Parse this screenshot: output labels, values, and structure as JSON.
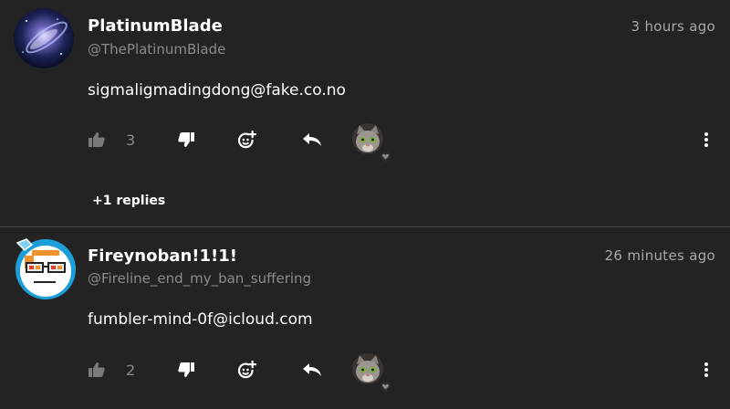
{
  "comments": [
    {
      "author": "PlatinumBlade",
      "handle": "@ThePlatinumBlade",
      "time": "3 hours ago",
      "text": "sigmaligmadingdong@fake.co.no",
      "likes": "3",
      "replies_label": "+1 replies",
      "avatar_icon": "galaxy-avatar",
      "reaction_icon": "cat-reaction-avatar"
    },
    {
      "author": "Fireynoban!1!1!",
      "handle": "@Fireline_end_my_ban_suffering",
      "time": "26 minutes ago",
      "text": "fumbler-mind-0f@icloud.com",
      "likes": "2",
      "avatar_icon": "pixel-face-avatar",
      "reaction_icon": "cat-reaction-avatar"
    }
  ],
  "icons": {
    "like": "thumbs-up-icon",
    "dislike": "thumbs-down-icon",
    "react": "add-reaction-icon",
    "reply": "reply-icon",
    "more": "more-vertical-icon"
  },
  "colors": {
    "background": "#232323",
    "muted": "#8b8b8b",
    "divider": "#4a4a4a"
  }
}
